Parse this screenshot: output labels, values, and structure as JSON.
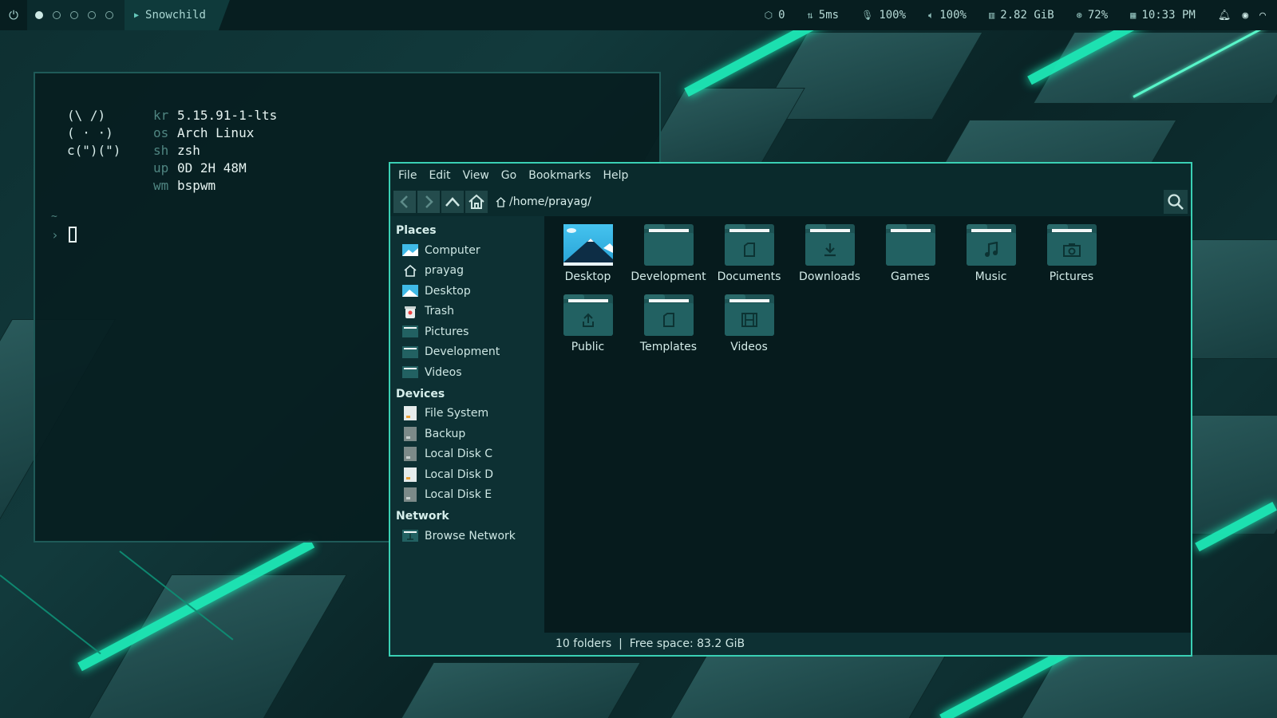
{
  "topbar": {
    "window_title": "Snowchild",
    "workspaces": [
      true,
      false,
      false,
      false,
      false
    ],
    "status": {
      "updates": "0",
      "ping": "5ms",
      "mic": "100%",
      "volume": "100%",
      "memory": "2.82 GiB",
      "cpu": "72%",
      "time": "10:33 PM"
    }
  },
  "terminal": {
    "ascii": [
      "(\\ /)",
      "( · ·)",
      "c(\")(\")"
    ],
    "info": [
      {
        "key": "kr",
        "value": "5.15.91-1-lts"
      },
      {
        "key": "os",
        "value": "Arch Linux"
      },
      {
        "key": "sh",
        "value": "zsh"
      },
      {
        "key": "up",
        "value": "0D 2H 48M"
      },
      {
        "key": "wm",
        "value": "bspwm"
      }
    ],
    "tilde": "~",
    "prompt_symbol": "›"
  },
  "file_manager": {
    "menu": [
      "File",
      "Edit",
      "View",
      "Go",
      "Bookmarks",
      "Help"
    ],
    "path": "/home/prayag/",
    "sidebar": {
      "places_title": "Places",
      "places": [
        "Computer",
        "prayag",
        "Desktop",
        "Trash",
        "Pictures",
        "Development",
        "Videos"
      ],
      "devices_title": "Devices",
      "devices": [
        "File System",
        "Backup",
        "Local Disk C",
        "Local Disk D",
        "Local Disk E"
      ],
      "network_title": "Network",
      "network": [
        "Browse Network"
      ]
    },
    "items": [
      {
        "name": "Desktop",
        "icon": "desktop-icon"
      },
      {
        "name": "Development",
        "icon": "folder-icon"
      },
      {
        "name": "Documents",
        "icon": "document-icon"
      },
      {
        "name": "Downloads",
        "icon": "download-icon"
      },
      {
        "name": "Games",
        "icon": "folder-icon"
      },
      {
        "name": "Music",
        "icon": "music-icon"
      },
      {
        "name": "Pictures",
        "icon": "camera-icon"
      },
      {
        "name": "Public",
        "icon": "share-icon"
      },
      {
        "name": "Templates",
        "icon": "document-icon"
      },
      {
        "name": "Videos",
        "icon": "film-icon"
      }
    ],
    "statusbar": "10 folders  |  Free space: 83.2 GiB"
  }
}
